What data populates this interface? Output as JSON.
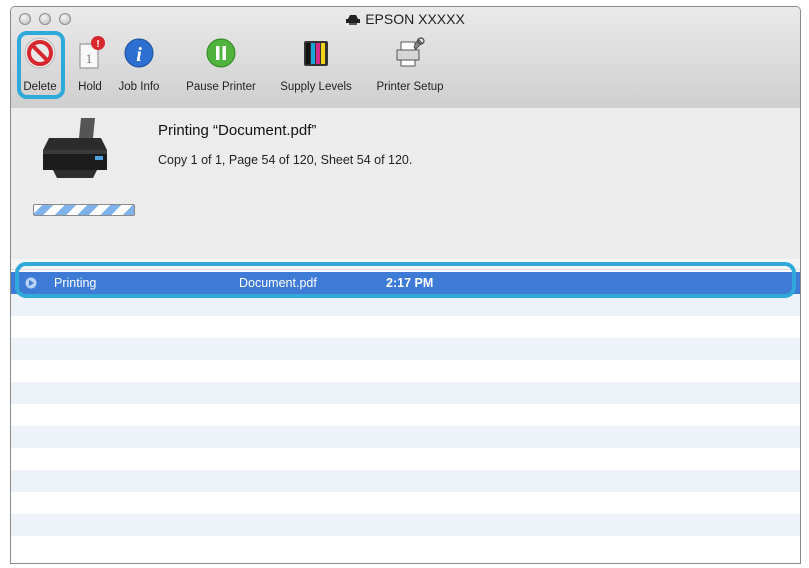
{
  "window": {
    "title": "EPSON XXXXX"
  },
  "toolbar": {
    "delete_label": "Delete",
    "hold_label": "Hold",
    "jobinfo_label": "Job Info",
    "pause_label": "Pause Printer",
    "supply_label": "Supply Levels",
    "setup_label": "Printer Setup"
  },
  "status": {
    "title": "Printing “Document.pdf”",
    "detail": "Copy 1 of 1, Page 54 of 120, Sheet 54 of 120."
  },
  "jobs": [
    {
      "status": "Printing",
      "name": "Document.pdf",
      "time": "2:17 PM"
    }
  ],
  "colors": {
    "highlight": "#2fa9d9",
    "selection": "#3d7bd7",
    "stripe": "#edf2f9"
  }
}
